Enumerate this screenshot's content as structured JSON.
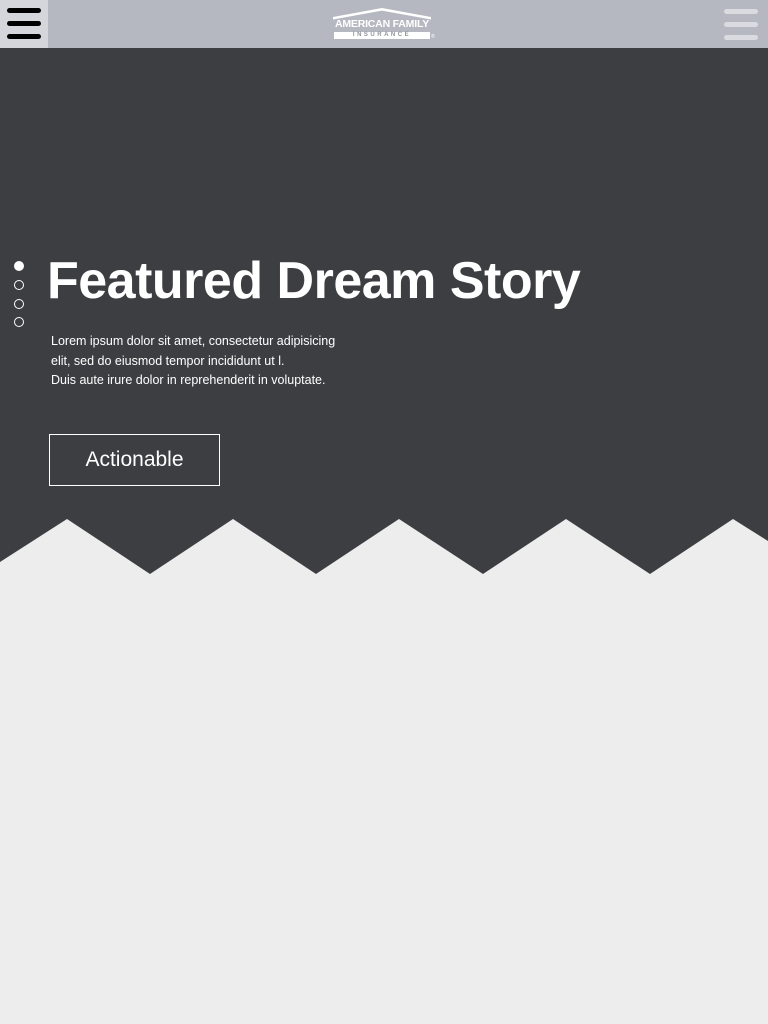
{
  "header": {
    "logo": {
      "line1": "AMERICAN FAMILY",
      "line2": "INSURANCE",
      "mark": "®"
    },
    "left_menu_icon": "hamburger-menu-icon",
    "right_menu_icon": "hamburger-menu-icon"
  },
  "hero": {
    "title": "Featured Dream Story",
    "body_lines": [
      "Lorem ipsum dolor sit amet, consectetur adipisicing",
      "elit, sed do eiusmod tempor incididunt ut l.",
      "Duis aute irure dolor in reprehenderit in voluptate."
    ],
    "cta_label": "Actionable",
    "slides": {
      "count": 4,
      "active": 1
    }
  },
  "colors": {
    "header_bg": "#b5b8c0",
    "hero_bg": "#3d3e41",
    "page_bg": "#ededed",
    "text": "#ffffff"
  }
}
